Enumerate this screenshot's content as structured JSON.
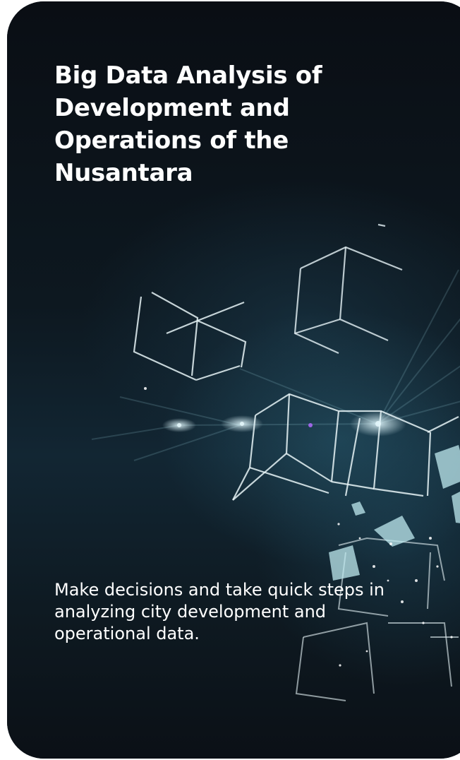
{
  "card": {
    "title": "Big Data Analysis of Development and Operations of the Nusantara",
    "description": "Make decisions and take quick steps in analyzing city development and operational data.",
    "background_image": "abstract-light-cubes"
  },
  "colors": {
    "card_background": "#0b1016",
    "text": "#ffffff",
    "glow": "#7fd3e0"
  }
}
